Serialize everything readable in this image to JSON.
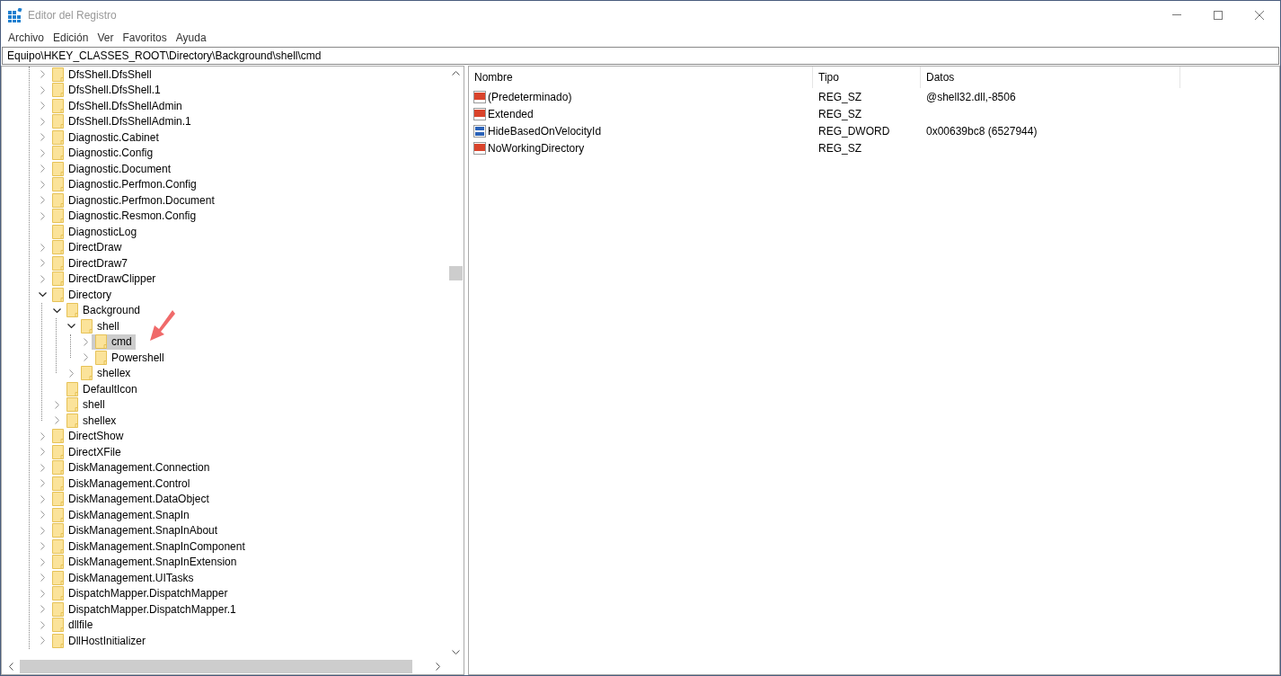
{
  "window": {
    "title": "Editor del Registro"
  },
  "menu": [
    "Archivo",
    "Edición",
    "Ver",
    "Favoritos",
    "Ayuda"
  ],
  "address": "Equipo\\HKEY_CLASSES_ROOT\\Directory\\Background\\shell\\cmd",
  "tree": [
    {
      "label": "DfsShell.DfsShell",
      "expanded": false,
      "selected": false
    },
    {
      "label": "DfsShell.DfsShell.1",
      "expanded": false,
      "selected": false
    },
    {
      "label": "DfsShell.DfsShellAdmin",
      "expanded": false,
      "selected": false
    },
    {
      "label": "DfsShell.DfsShellAdmin.1",
      "expanded": false,
      "selected": false
    },
    {
      "label": "Diagnostic.Cabinet",
      "expanded": false,
      "selected": false
    },
    {
      "label": "Diagnostic.Config",
      "expanded": false,
      "selected": false
    },
    {
      "label": "Diagnostic.Document",
      "expanded": false,
      "selected": false
    },
    {
      "label": "Diagnostic.Perfmon.Config",
      "expanded": false,
      "selected": false
    },
    {
      "label": "Diagnostic.Perfmon.Document",
      "expanded": false,
      "selected": false
    },
    {
      "label": "Diagnostic.Resmon.Config",
      "expanded": false,
      "selected": false
    },
    {
      "label": "DiagnosticLog",
      "selected": false
    },
    {
      "label": "DirectDraw",
      "expanded": false,
      "selected": false
    },
    {
      "label": "DirectDraw7",
      "expanded": false,
      "selected": false
    },
    {
      "label": "DirectDrawClipper",
      "expanded": false,
      "selected": false
    },
    {
      "label": "Directory",
      "expanded": true,
      "selected": false,
      "children": [
        {
          "label": "Background",
          "expanded": true,
          "selected": false,
          "children": [
            {
              "label": "shell",
              "expanded": true,
              "selected": false,
              "children": [
                {
                  "label": "cmd",
                  "expanded": false,
                  "selected": true
                },
                {
                  "label": "Powershell",
                  "expanded": false,
                  "selected": false
                }
              ]
            },
            {
              "label": "shellex",
              "expanded": false,
              "selected": false
            }
          ]
        },
        {
          "label": "DefaultIcon",
          "selected": false
        },
        {
          "label": "shell",
          "expanded": false,
          "selected": false
        },
        {
          "label": "shellex",
          "expanded": false,
          "selected": false
        }
      ]
    },
    {
      "label": "DirectShow",
      "expanded": false,
      "selected": false
    },
    {
      "label": "DirectXFile",
      "expanded": false,
      "selected": false
    },
    {
      "label": "DiskManagement.Connection",
      "expanded": false,
      "selected": false
    },
    {
      "label": "DiskManagement.Control",
      "expanded": false,
      "selected": false
    },
    {
      "label": "DiskManagement.DataObject",
      "expanded": false,
      "selected": false
    },
    {
      "label": "DiskManagement.SnapIn",
      "expanded": false,
      "selected": false
    },
    {
      "label": "DiskManagement.SnapInAbout",
      "expanded": false,
      "selected": false
    },
    {
      "label": "DiskManagement.SnapInComponent",
      "expanded": false,
      "selected": false
    },
    {
      "label": "DiskManagement.SnapInExtension",
      "expanded": false,
      "selected": false
    },
    {
      "label": "DiskManagement.UITasks",
      "expanded": false,
      "selected": false
    },
    {
      "label": "DispatchMapper.DispatchMapper",
      "expanded": false,
      "selected": false
    },
    {
      "label": "DispatchMapper.DispatchMapper.1",
      "expanded": false,
      "selected": false
    },
    {
      "label": "dllfile",
      "expanded": false,
      "selected": false
    },
    {
      "label": "DllHostInitializer",
      "expanded": false,
      "selected": false
    }
  ],
  "values": {
    "columns": [
      "Nombre",
      "Tipo",
      "Datos"
    ],
    "rows": [
      {
        "kind": "string",
        "name": "(Predeterminado)",
        "type": "REG_SZ",
        "data": "@shell32.dll,-8506"
      },
      {
        "kind": "string",
        "name": "Extended",
        "type": "REG_SZ"
      },
      {
        "kind": "dword",
        "name": "HideBasedOnVelocityId",
        "type": "REG_DWORD",
        "data": "0x00639bc8 (6527944)"
      },
      {
        "kind": "string",
        "name": "NoWorkingDirectory",
        "type": "REG_SZ"
      }
    ]
  }
}
